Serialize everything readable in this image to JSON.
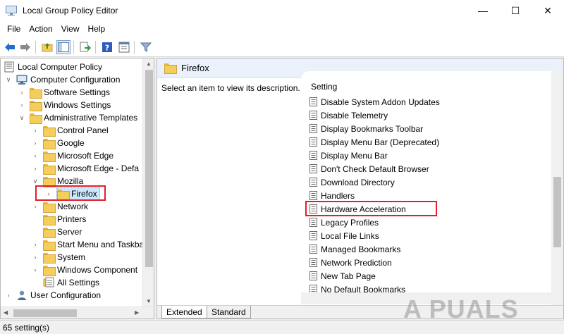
{
  "window": {
    "title": "Local Group Policy Editor"
  },
  "menu": [
    "File",
    "Action",
    "View",
    "Help"
  ],
  "tree": {
    "items": [
      {
        "label": "Local Computer Policy"
      },
      {
        "label": "Computer Configuration"
      },
      {
        "label": "Software Settings"
      },
      {
        "label": "Windows Settings"
      },
      {
        "label": "Administrative Templates"
      },
      {
        "label": "Control Panel"
      },
      {
        "label": "Google"
      },
      {
        "label": "Microsoft Edge"
      },
      {
        "label": "Microsoft Edge - Defa"
      },
      {
        "label": "Mozilla"
      },
      {
        "label": "Firefox"
      },
      {
        "label": "Network"
      },
      {
        "label": "Printers"
      },
      {
        "label": "Server"
      },
      {
        "label": "Start Menu and Taskba"
      },
      {
        "label": "System"
      },
      {
        "label": "Windows Component"
      },
      {
        "label": "All Settings"
      },
      {
        "label": "User Configuration"
      }
    ]
  },
  "details": {
    "folder_title": "Firefox",
    "description": "Select an item to view its description.",
    "column_header": "Setting",
    "settings": [
      "Disable System Addon Updates",
      "Disable Telemetry",
      "Display Bookmarks Toolbar",
      "Display Menu Bar (Deprecated)",
      "Display Menu Bar",
      "Don't Check Default Browser",
      "Download Directory",
      "Handlers",
      "Hardware Acceleration",
      "Legacy Profiles",
      "Local File Links",
      "Managed Bookmarks",
      "Network Prediction",
      "New Tab Page",
      "No Default Bookmarks"
    ]
  },
  "tabs": [
    "Extended",
    "Standard"
  ],
  "status": {
    "text": "65 setting(s)"
  },
  "watermark": "A PUALS",
  "colors": {
    "highlight": "#e0202a",
    "folder": "#f5cd5a",
    "header_bg": "#eaf1fb"
  }
}
